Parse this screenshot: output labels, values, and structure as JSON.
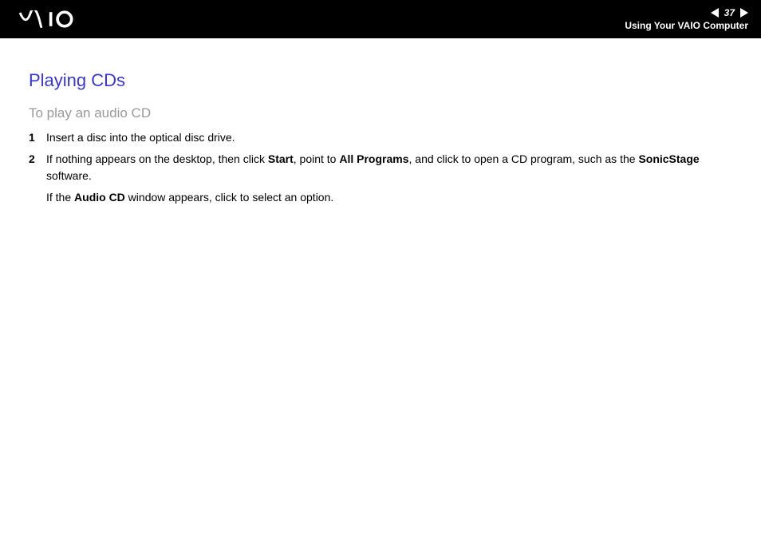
{
  "header": {
    "page_number": "37",
    "section_title": "Using Your VAIO Computer"
  },
  "content": {
    "heading": "Playing CDs",
    "subheading": "To play an audio CD",
    "steps": [
      {
        "num": "1",
        "text_parts": [
          "Insert a disc into the optical disc drive."
        ]
      },
      {
        "num": "2",
        "text_prefix": "If nothing appears on the desktop, then click ",
        "bold1": "Start",
        "text_mid1": ", point to ",
        "bold2": "All Programs",
        "text_mid2": ", and click to open a CD program, such as the ",
        "bold3": "SonicStage",
        "text_suffix": " software.",
        "note_prefix": "If the ",
        "note_bold": "Audio CD",
        "note_suffix": " window appears, click to select an option."
      }
    ]
  }
}
